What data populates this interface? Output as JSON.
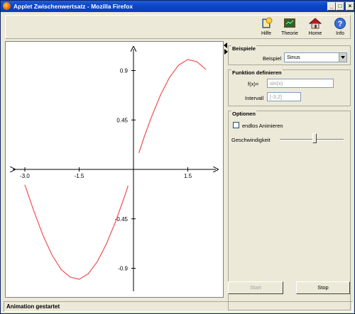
{
  "window": {
    "title": "Applet Zwischenwertsatz - Mozilla Firefox",
    "min_label": "_",
    "max_label": "□",
    "close_label": "×"
  },
  "toolbar": {
    "items": [
      {
        "label": "Hilfe",
        "icon": "help-book-icon"
      },
      {
        "label": "Theorie",
        "icon": "chalkboard-icon"
      },
      {
        "label": "Home",
        "icon": "home-icon"
      },
      {
        "label": "Info",
        "icon": "info-icon"
      }
    ]
  },
  "beispiele": {
    "title": "Beispiele",
    "label": "Beispiel",
    "selected": "Sinus"
  },
  "funktion": {
    "title": "Funktion definieren",
    "fx_label": "f(x)=",
    "fx_value": "sin(x)",
    "interval_label": "Intervall",
    "interval_value": "[-3,2]"
  },
  "optionen": {
    "title": "Optionen",
    "checkbox_label": "endlos Animieren",
    "speed_label": "Geschwindigkeit"
  },
  "buttons": {
    "start": "Start",
    "stop": "Stop"
  },
  "status": "Animation gestartet",
  "colors": {
    "curve": "#f05050",
    "titlebar": "#0a48c8"
  },
  "chart_data": {
    "type": "line",
    "xlim": [
      -3.2,
      2.05
    ],
    "ylim": [
      -1.15,
      1.0
    ],
    "x_ticks": [
      "-3.0",
      "-1.5",
      "1.5"
    ],
    "x_tick_values": [
      -3.0,
      -1.5,
      1.5
    ],
    "y_ticks": [
      "0.9",
      "0.45",
      "-0.45",
      "-0.9"
    ],
    "y_tick_values": [
      0.9,
      0.45,
      -0.45,
      -0.9
    ],
    "series": [
      {
        "segments": [
          {
            "x": [
              -3.0,
              -2.75,
              -2.5,
              -2.25,
              -2.0,
              -1.75,
              -1.5,
              -1.25,
              -1.0,
              -0.75,
              -0.5,
              -0.25,
              -0.15
            ],
            "y": [
              -0.14,
              -0.38,
              -0.6,
              -0.78,
              -0.91,
              -0.98,
              -1.0,
              -0.95,
              -0.84,
              -0.68,
              -0.48,
              -0.25,
              -0.15
            ]
          },
          {
            "x": [
              0.15,
              0.3,
              0.5,
              0.75,
              1.0,
              1.25,
              1.5,
              1.75,
              2.0
            ],
            "y": [
              0.15,
              0.3,
              0.48,
              0.68,
              0.84,
              0.95,
              1.0,
              0.98,
              0.91
            ]
          }
        ]
      }
    ]
  }
}
